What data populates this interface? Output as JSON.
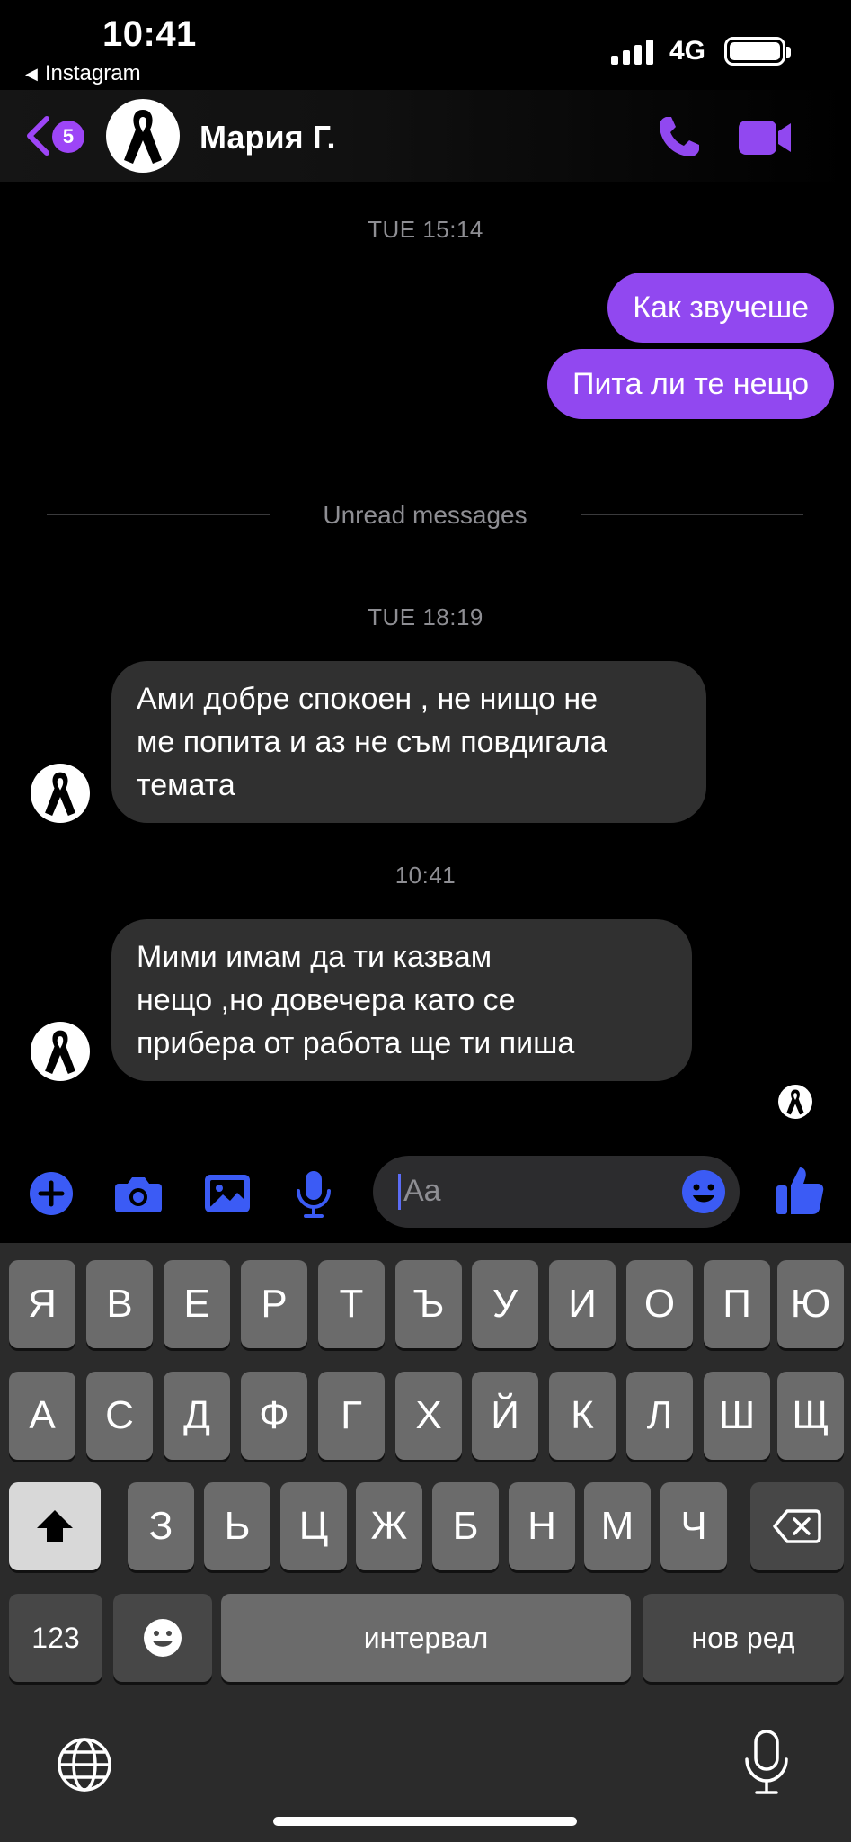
{
  "status_bar": {
    "time": "10:41",
    "back_app": "Instagram",
    "network": "4G"
  },
  "header": {
    "unread_count": "5",
    "contact_name": "Мария Г."
  },
  "chat": {
    "timestamp_1": "TUE 15:14",
    "outgoing_1": "Как звучеше",
    "outgoing_2": "Пита ли те нещо",
    "unread_divider": "Unread messages",
    "timestamp_2": "TUE 18:19",
    "incoming_1_lines": [
      "Ами добре спокоен , не нищо не",
      "ме попита и аз не съм повдигала",
      "темата"
    ],
    "timestamp_3": "10:41",
    "incoming_2_lines": [
      "Мими имам да ти казвам",
      "нещо ,но довечера като се",
      "прибера от работа ще ти пиша"
    ]
  },
  "composer": {
    "placeholder": "Aa"
  },
  "keyboard": {
    "row1": [
      "Я",
      "В",
      "Е",
      "Р",
      "Т",
      "Ъ",
      "У",
      "И",
      "О",
      "П",
      "Ю"
    ],
    "row2": [
      "А",
      "С",
      "Д",
      "Ф",
      "Г",
      "Х",
      "Й",
      "К",
      "Л",
      "Ш",
      "Щ"
    ],
    "row3": [
      "З",
      "Ь",
      "Ц",
      "Ж",
      "Б",
      "Н",
      "М",
      "Ч"
    ],
    "numbers_key": "123",
    "space_key": "интервал",
    "return_key": "нов ред"
  },
  "colors": {
    "accent": "#9148f0",
    "composer_icons": "#3b5bf5"
  }
}
